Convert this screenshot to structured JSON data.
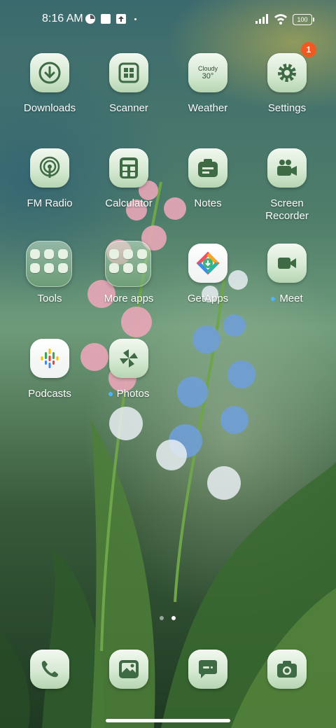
{
  "status_bar": {
    "time": "8:16 AM",
    "battery": "100"
  },
  "apps": [
    {
      "id": "downloads",
      "label": "Downloads",
      "icon": "download-icon"
    },
    {
      "id": "scanner",
      "label": "Scanner",
      "icon": "scanner-icon"
    },
    {
      "id": "weather",
      "label": "Weather",
      "icon": "weather-icon",
      "condition": "Cloudy",
      "temp": "30°"
    },
    {
      "id": "settings",
      "label": "Settings",
      "icon": "gear-icon",
      "badge": "1"
    },
    {
      "id": "fm-radio",
      "label": "FM Radio",
      "icon": "radio-icon"
    },
    {
      "id": "calculator",
      "label": "Calculator",
      "icon": "calculator-icon"
    },
    {
      "id": "notes",
      "label": "Notes",
      "icon": "notes-icon"
    },
    {
      "id": "screen-recorder",
      "label": "Screen\nRecorder",
      "icon": "video-camera-icon"
    },
    {
      "id": "tools",
      "label": "Tools",
      "icon": "folder-icon"
    },
    {
      "id": "more-apps",
      "label": "More apps",
      "icon": "folder-icon"
    },
    {
      "id": "getapps",
      "label": "GetApps",
      "icon": "getapps-icon"
    },
    {
      "id": "meet",
      "label": "Meet",
      "icon": "meet-icon"
    },
    {
      "id": "podcasts",
      "label": "Podcasts",
      "icon": "podcasts-icon"
    },
    {
      "id": "photos",
      "label": "Photos",
      "icon": "photos-icon"
    }
  ],
  "dock": [
    {
      "id": "phone",
      "icon": "phone-icon"
    },
    {
      "id": "gallery",
      "icon": "gallery-icon"
    },
    {
      "id": "messages",
      "icon": "message-icon"
    },
    {
      "id": "camera",
      "icon": "camera-icon"
    }
  ],
  "pages": {
    "count": 2,
    "current": 2
  },
  "colors": {
    "icon_glyph": "#3e6b43",
    "badge": "#f05a22",
    "new_dot": "#4fb3ff"
  }
}
